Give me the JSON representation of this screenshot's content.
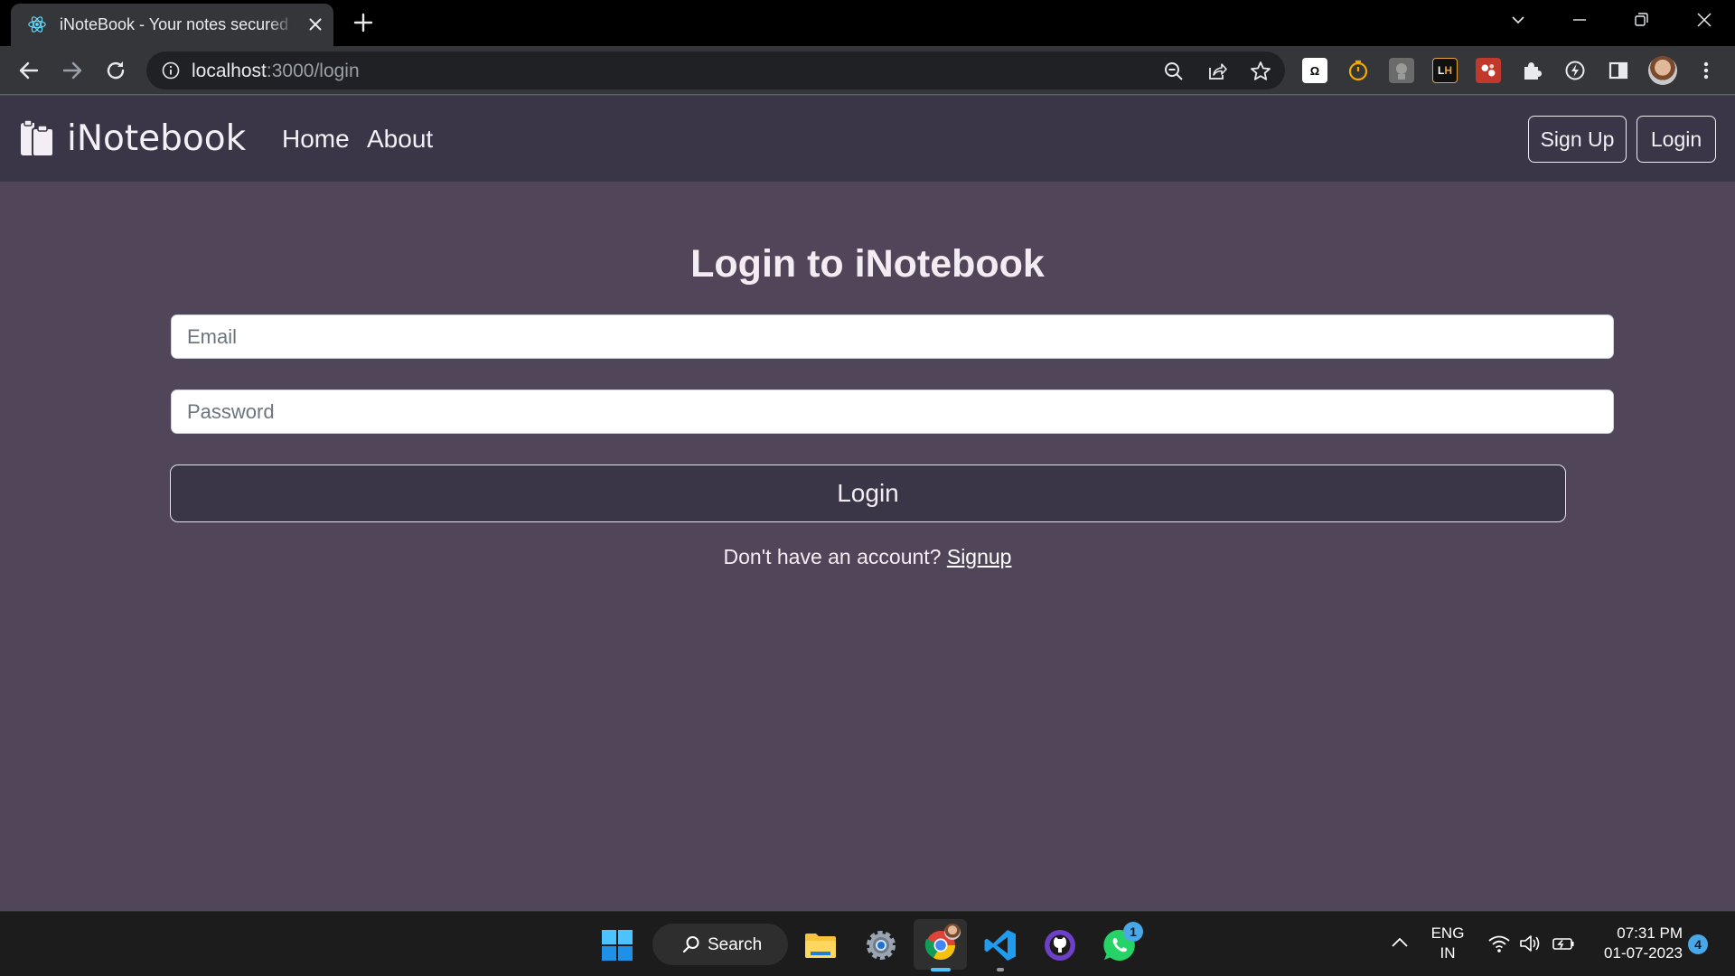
{
  "browser": {
    "tab_title": "iNoteBook - Your notes secured on the cloud",
    "url_host": "localhost",
    "url_rest": ":3000/login"
  },
  "navbar": {
    "brand": "iNotebook",
    "links": [
      "Home",
      "About"
    ],
    "signup_button": "Sign Up",
    "login_button": "Login"
  },
  "login": {
    "title": "Login to iNotebook",
    "email_placeholder": "Email",
    "password_placeholder": "Password",
    "submit_label": "Login",
    "no_account_text": "Don't have an account?",
    "signup_link": "Signup"
  },
  "taskbar": {
    "search_label": "Search",
    "whatsapp_badge": "1",
    "lang_line1": "ENG",
    "lang_line2": "IN",
    "time": "07:31 PM",
    "date": "01-07-2023",
    "notification_count": "4"
  },
  "colors": {
    "page_bg": "#51455a",
    "navbar_bg": "#3b3647",
    "button_bg": "#3b3647"
  }
}
